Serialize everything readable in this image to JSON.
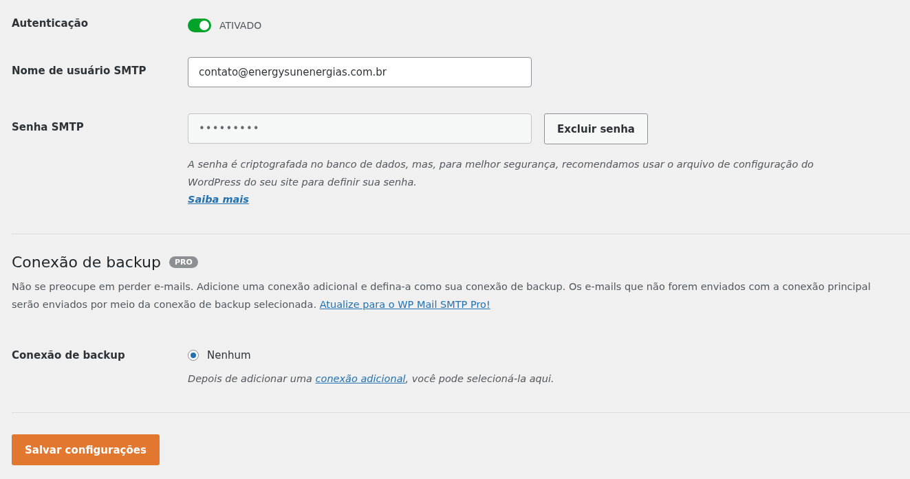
{
  "authentication": {
    "label": "Autenticação",
    "on": true,
    "state_label": "ATIVADO"
  },
  "smtp_username": {
    "label": "Nome de usuário SMTP",
    "value": "contato@energysunenergias.com.br"
  },
  "smtp_password": {
    "label": "Senha SMTP",
    "value": "•••••••••",
    "button": "Excluir senha",
    "help": "A senha é criptografada no banco de dados, mas, para melhor segurança, recomendamos usar o arquivo de configuração do WordPress do seu site para definir sua senha.",
    "link": "Saiba mais"
  },
  "backup_section": {
    "title": "Conexão de backup",
    "badge": "PRO",
    "description": "Não se preocupe em perder e-mails. Adicione uma conexão adicional e defina-a como sua conexão de backup. Os e-mails que não forem enviados com a conexão principal serão enviados por meio da conexão de backup selecionada.",
    "link": "Atualize para o WP Mail SMTP Pro!"
  },
  "backup_connection": {
    "label": "Conexão de backup",
    "options": [
      {
        "label": "Nenhum",
        "selected": true
      }
    ],
    "help_before": "Depois de adicionar uma",
    "help_link": "conexão adicional",
    "help_after": ", você pode selecioná-la aqui."
  },
  "save_button": "Salvar configurações"
}
